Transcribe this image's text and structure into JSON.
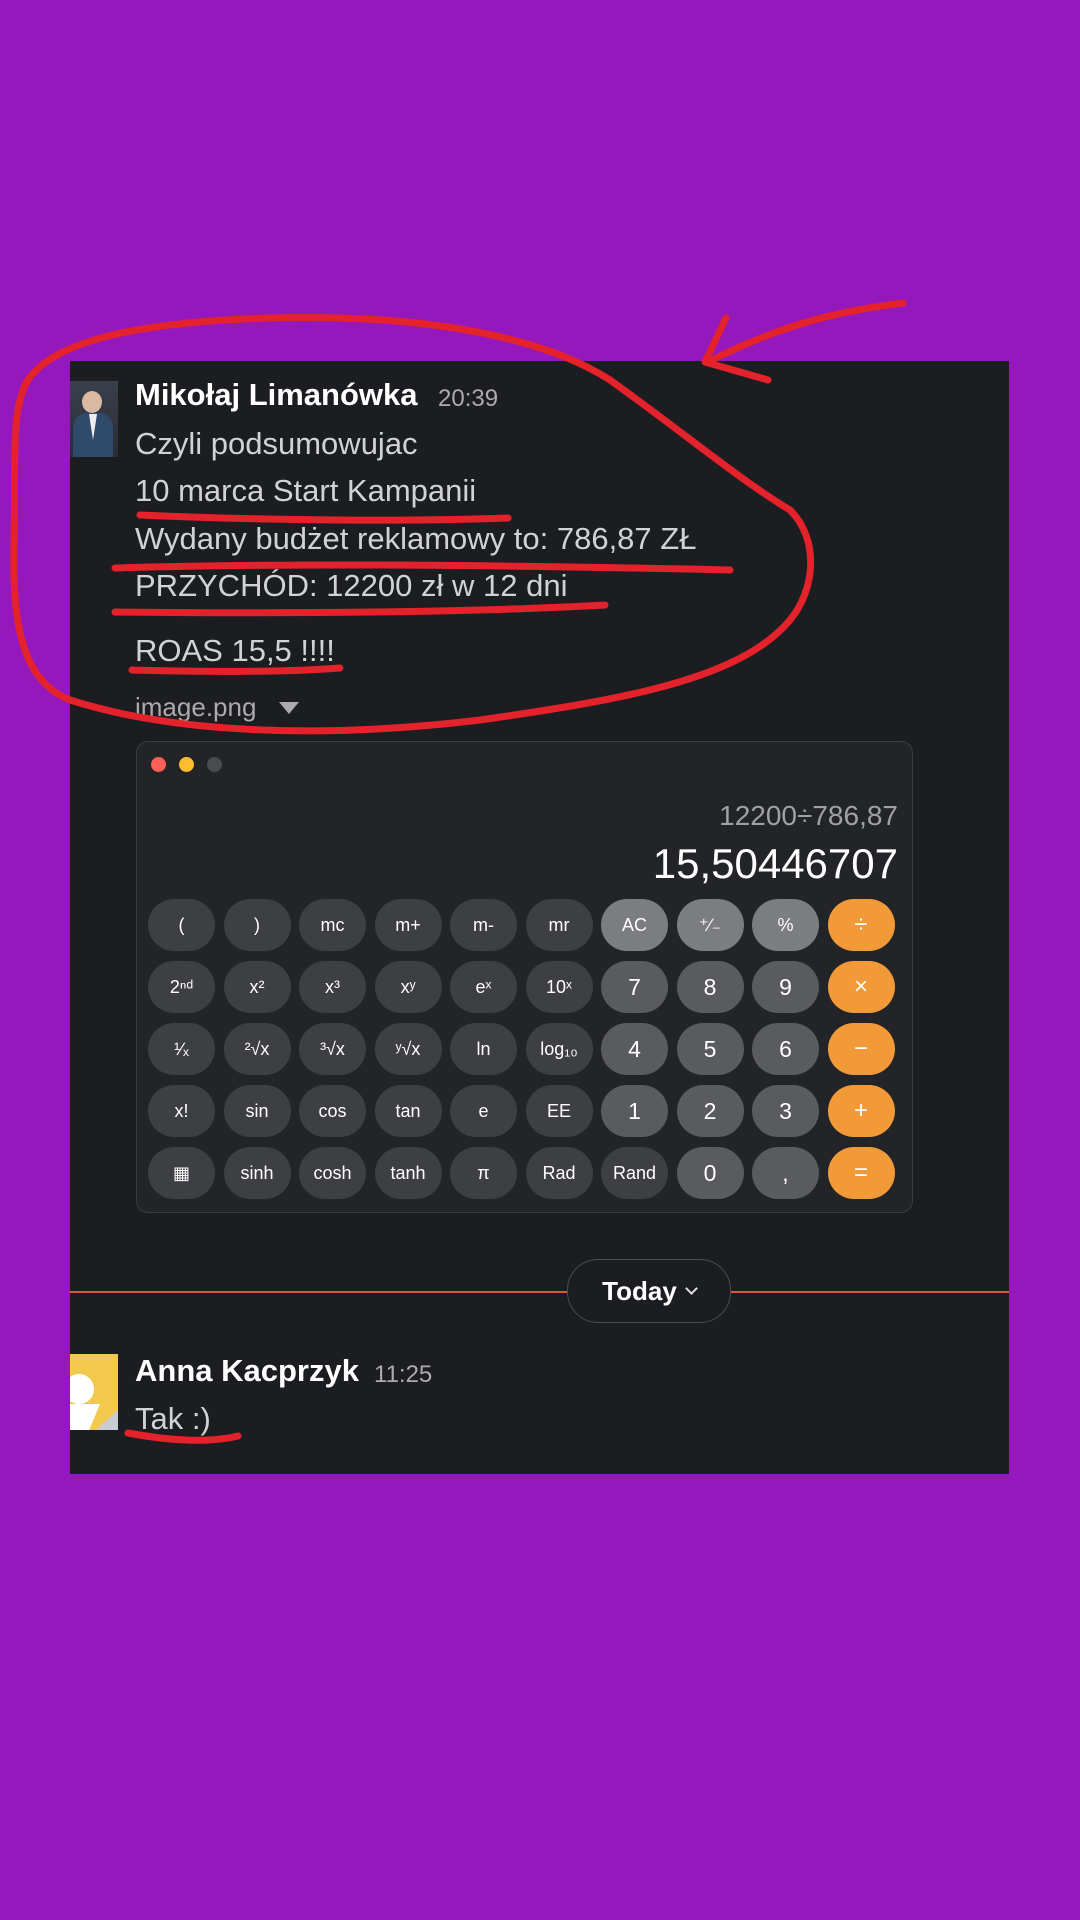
{
  "messages": [
    {
      "author": "Mikołaj Limanówka",
      "time": "20:39",
      "avatar": "profile-photo",
      "lines": [
        "Czyli podsumowujac",
        "10 marca Start Kampanii",
        "Wydany budżet reklamowy to: 786,87 ZŁ",
        "PRZYCHÓD: 12200 zł  w 12 dni",
        "ROAS 15,5 !!!!"
      ],
      "attachment": {
        "file_name": "image.png",
        "calculator": {
          "expression": "12200÷786,87",
          "result": "15,50446707",
          "keys": [
            "(",
            ")",
            "mc",
            "m+",
            "m-",
            "mr",
            "AC",
            "⁺∕₋",
            "%",
            "÷",
            "2ⁿᵈ",
            "x²",
            "x³",
            "xʸ",
            "eˣ",
            "10ˣ",
            "7",
            "8",
            "9",
            "×",
            "¹∕ₓ",
            "²√x",
            "³√x",
            "ʸ√x",
            "ln",
            "log₁₀",
            "4",
            "5",
            "6",
            "−",
            "x!",
            "sin",
            "cos",
            "tan",
            "e",
            "EE",
            "1",
            "2",
            "3",
            "+",
            "calculator-icon",
            "sinh",
            "cosh",
            "tanh",
            "π",
            "Rad",
            "Rand",
            "0",
            ",",
            "="
          ]
        }
      }
    },
    {
      "author": "Anna Kacprzyk",
      "time": "11:25",
      "avatar": "default-yellow",
      "lines": [
        "Tak :)"
      ]
    }
  ],
  "divider": {
    "label": "Today"
  },
  "colors": {
    "background": "#9518BD",
    "chat_bg": "#1B1D21",
    "annotation": "#E3222B",
    "divider": "#D65A3E",
    "operator_key": "#F19A37"
  }
}
